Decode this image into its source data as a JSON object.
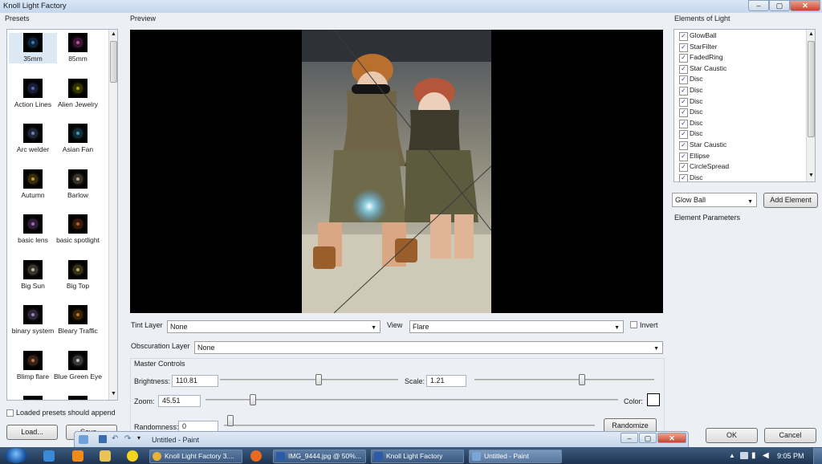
{
  "window": {
    "title": "Knoll Light Factory"
  },
  "presets": {
    "label": "Presets",
    "items": [
      {
        "label": "35mm",
        "color": "#4aa3ff"
      },
      {
        "label": "85mm",
        "color": "#ff6ad5"
      },
      {
        "label": "Action Lines",
        "color": "#6e8cff"
      },
      {
        "label": "Alien Jewelry",
        "color": "#e6e600"
      },
      {
        "label": "Arc welder",
        "color": "#8fb6ff"
      },
      {
        "label": "Asian Fan",
        "color": "#5ad1ff"
      },
      {
        "label": "Autumn",
        "color": "#ffd23a"
      },
      {
        "label": "Barlow",
        "color": "#ffe7c2"
      },
      {
        "label": "basic lens",
        "color": "#e08cff"
      },
      {
        "label": "basic spotlight",
        "color": "#ff7a3a"
      },
      {
        "label": "Big Sun",
        "color": "#fff6c8"
      },
      {
        "label": "Big Top",
        "color": "#ffe27a"
      },
      {
        "label": "binary system",
        "color": "#d6b4ff"
      },
      {
        "label": "Bleary Traffic",
        "color": "#ffa320"
      },
      {
        "label": "Blimp flare",
        "color": "#ff9f6a"
      },
      {
        "label": "Blue Green Eye",
        "color": "#ffffff"
      },
      {
        "label": "",
        "color": "#8fc3ff"
      },
      {
        "label": "",
        "color": "#8fc3ff"
      }
    ],
    "append_label": "Loaded presets should append",
    "load_button": "Load...",
    "save_button": "Save..."
  },
  "preview": {
    "label": "Preview"
  },
  "tint_layer": {
    "label": "Tint Layer",
    "value": "None"
  },
  "view": {
    "label": "View",
    "value": "Flare"
  },
  "invert": {
    "label": "Invert"
  },
  "obscuration": {
    "label": "Obscuration Layer",
    "value": "None"
  },
  "master": {
    "label": "Master Controls",
    "brightness_label": "Brightness:",
    "brightness_value": "110.81",
    "scale_label": "Scale:",
    "scale_value": "1.21",
    "zoom_label": "Zoom:",
    "zoom_value": "45.51",
    "color_label": "Color:",
    "randomness_label": "Randomness:",
    "randomness_value": "0",
    "randomize_button": "Randomize"
  },
  "elements": {
    "label": "Elements of Light",
    "items": [
      "GlowBall",
      "StarFilter",
      "FadedRing",
      "Star Caustic",
      "Disc",
      "Disc",
      "Disc",
      "Disc",
      "Disc",
      "Disc",
      "Star Caustic",
      "Ellipse",
      "CircleSpread",
      "Disc"
    ],
    "selected": "Glow Ball",
    "add_button": "Add Element",
    "params_label": "Element Parameters"
  },
  "dialog": {
    "ok": "OK",
    "cancel": "Cancel"
  },
  "paint": {
    "title": "Untitled - Paint"
  },
  "taskbar": {
    "tasks": [
      {
        "label": "Knoll Light Factory 3....",
        "color": "#e6b23a"
      },
      {
        "label": "IMG_9444.jpg @ 50%...",
        "color": "#2a5aa8"
      },
      {
        "label": "Knoll Light Factory",
        "color": "#2a5aa8"
      },
      {
        "label": "Untitled - Paint",
        "color": "#7aa6d6"
      }
    ],
    "clock": "9:05 PM"
  }
}
